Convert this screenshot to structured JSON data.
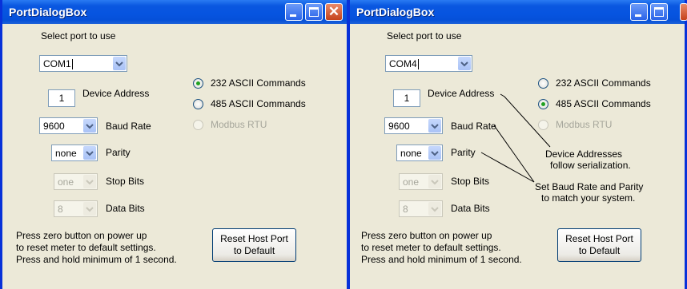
{
  "windows": [
    {
      "title": "PortDialogBox",
      "select_port_label": "Select port to use",
      "port_value": "COM1",
      "device_address_value": "1",
      "device_address_label": "Device Address",
      "radio_232": "232 ASCII Commands",
      "radio_485": "485 ASCII Commands",
      "radio_modbus": "Modbus RTU",
      "selected_mode": "232",
      "baud_value": "9600",
      "baud_label": "Baud Rate",
      "parity_value": "none",
      "parity_label": "Parity",
      "stop_value": "one",
      "stop_label": "Stop Bits",
      "data_value": "8",
      "data_label": "Data Bits",
      "footer_line1": "Press zero button on power up",
      "footer_line2": "to reset meter to default settings.",
      "footer_line3": "Press and hold minimum of 1 second.",
      "reset_line1": "Reset Host Port",
      "reset_line2": "to Default"
    },
    {
      "title": "PortDialogBox",
      "select_port_label": "Select port to use",
      "port_value": "COM4",
      "device_address_value": "1",
      "device_address_label": "Device Address",
      "radio_232": "232 ASCII Commands",
      "radio_485": "485 ASCII Commands",
      "radio_modbus": "Modbus RTU",
      "selected_mode": "485",
      "baud_value": "9600",
      "baud_label": "Baud Rate",
      "parity_value": "none",
      "parity_label": "Parity",
      "stop_value": "one",
      "stop_label": "Stop Bits",
      "data_value": "8",
      "data_label": "Data Bits",
      "footer_line1": "Press zero button on power up",
      "footer_line2": "to reset meter to default settings.",
      "footer_line3": "Press and hold minimum of 1 second.",
      "reset_line1": "Reset Host Port",
      "reset_line2": "to Default"
    }
  ],
  "annotations": {
    "note1_line1": "Device Addresses",
    "note1_line2": "follow serialization.",
    "note2_line1": "Set Baud Rate and Parity",
    "note2_line2": "to match your system."
  }
}
